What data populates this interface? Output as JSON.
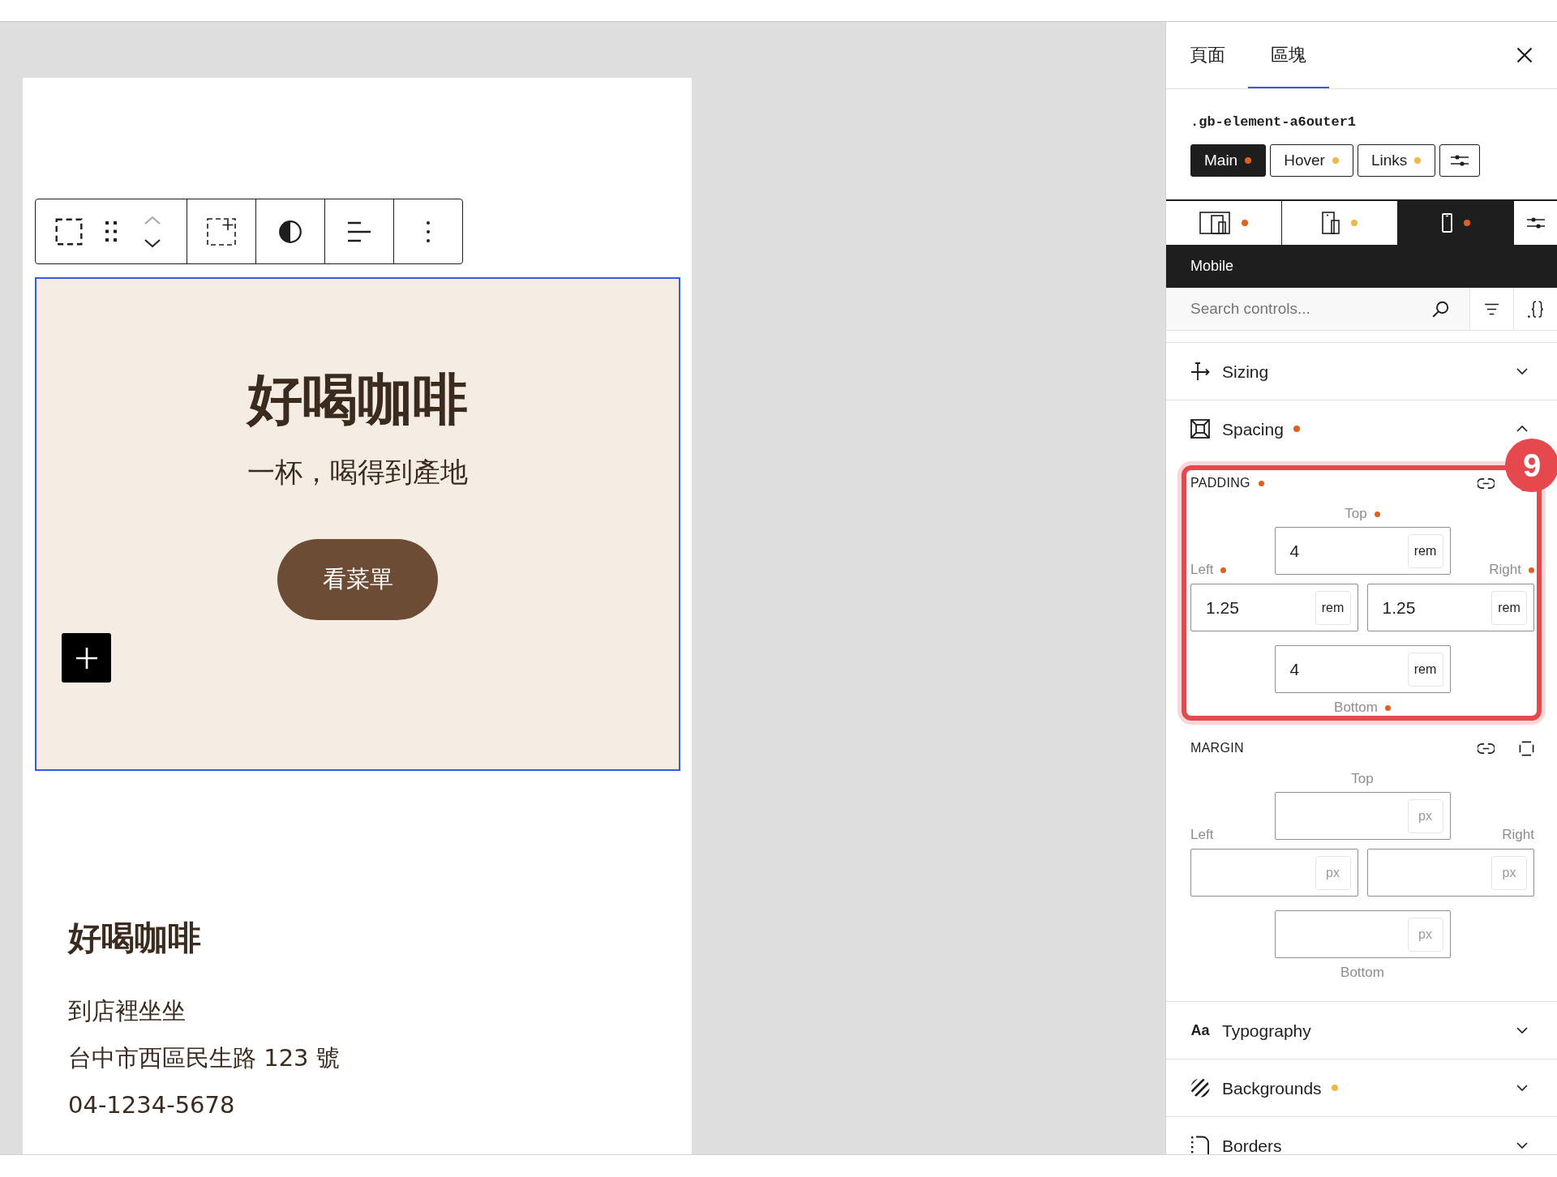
{
  "canvas": {
    "block_toolbar": {
      "move_up": {
        "disabled": true
      },
      "move_down": {
        "disabled": false
      }
    },
    "hero": {
      "selected": true,
      "title": "好喝咖啡",
      "subtitle": "一杯，喝得到產地",
      "button": "看菜單"
    },
    "info": {
      "heading": "好喝咖啡",
      "lines": [
        "到店裡坐坐",
        "台中市西區民生路 123 號",
        "04-1234-5678"
      ]
    }
  },
  "sidebar": {
    "tabs": [
      {
        "label": "頁面",
        "selected": false
      },
      {
        "label": "區塊",
        "selected": true
      }
    ],
    "selector": ".gb-element-a6outer1",
    "states": [
      {
        "label": "Main",
        "selected": true,
        "color": "#e0601e"
      },
      {
        "label": "Hover",
        "selected": false,
        "color": "#f0b849"
      },
      {
        "label": "Links",
        "selected": false,
        "color": "#f0b849"
      }
    ],
    "devices": [
      {
        "kind": "desktop",
        "selected": false,
        "color": "#e0601e"
      },
      {
        "kind": "tablet",
        "selected": false,
        "color": "#f0b849"
      },
      {
        "kind": "mobile",
        "selected": true,
        "color": "#e0601e"
      }
    ],
    "device_label": "Mobile",
    "search": {
      "placeholder": "Search controls..."
    },
    "panels": [
      {
        "kind": "sizing",
        "title": "Sizing",
        "expanded": false
      },
      {
        "kind": "spacing",
        "title": "Spacing",
        "expanded": true,
        "color": "#e0601e",
        "groups": [
          {
            "title": "PADDING",
            "color": "#e0601e",
            "callout": "9",
            "top": {
              "label": "Top",
              "value": "4",
              "unit": "rem",
              "color": "#e0601e"
            },
            "left": {
              "label": "Left",
              "value": "1.25",
              "unit": "rem",
              "color": "#e0601e"
            },
            "right": {
              "label": "Right",
              "value": "1.25",
              "unit": "rem",
              "color": "#e0601e"
            },
            "bottom": {
              "label": "Bottom",
              "value": "4",
              "unit": "rem",
              "color": "#e0601e"
            }
          },
          {
            "title": "MARGIN",
            "top": {
              "label": "Top",
              "unit": "px"
            },
            "left": {
              "label": "Left",
              "unit": "px"
            },
            "right": {
              "label": "Right",
              "unit": "px"
            },
            "bottom": {
              "label": "Bottom",
              "unit": "px"
            }
          }
        ]
      },
      {
        "kind": "typography",
        "title": "Typography",
        "expanded": false,
        "glyph": "Aa"
      },
      {
        "kind": "backgrounds",
        "title": "Backgrounds",
        "expanded": false,
        "color": "#f0b849"
      },
      {
        "kind": "borders",
        "title": "Borders",
        "expanded": false
      }
    ]
  }
}
